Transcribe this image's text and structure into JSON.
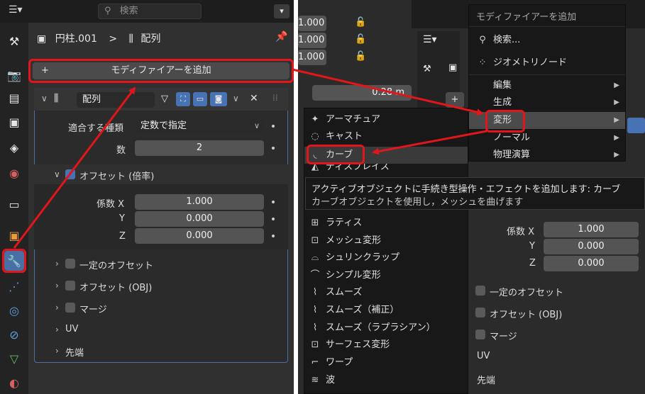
{
  "left": {
    "search_placeholder": "検索",
    "breadcrumb_object": "円柱.001",
    "breadcrumb_sep": ">",
    "breadcrumb_modifier": "配列",
    "add_modifier_label": "モディファイアーを追加",
    "modifier_name": "配列",
    "fit_type_label": "適合する種類",
    "fit_type_value": "定数で指定",
    "count_label": "数",
    "count_value": "2",
    "offset_header": "オフセット (倍率)",
    "factor_x_label": "係数 X",
    "factor_x_value": "1.000",
    "factor_y_label": "Y",
    "factor_y_value": "0.000",
    "factor_z_label": "Z",
    "factor_z_value": "0.000",
    "sections": [
      "一定のオフセット",
      "オフセット (OBJ)",
      "マージ",
      "UV",
      "先端"
    ]
  },
  "right": {
    "top_values": [
      "1.000",
      "1.000",
      "1.000"
    ],
    "length_value": "0.28 m",
    "menu_title": "モディファイアーを追加",
    "menu_search": "検索...",
    "geometry_nodes": "ジオメトリノード",
    "categories": [
      "編集",
      "生成",
      "変形",
      "ノーマル",
      "物理演算"
    ],
    "deform_items_top": [
      "アーマチュア",
      "キャスト",
      "カーブ",
      "ディスプレイス"
    ],
    "tooltip_line1": "アクティブオブジェクトに手続き型操作・エフェクトを追加します: カーブ",
    "tooltip_line2": "カーブオブジェクトを使用し，メッシュを曲げます",
    "deform_items_bottom": [
      "ラティス",
      "メッシュ変形",
      "シュリンクラップ",
      "シンプル変形",
      "スムーズ",
      "スムーズ（補正）",
      "スムーズ（ラプラシアン）",
      "サーフェス変形",
      "ワープ",
      "波"
    ],
    "factor_x_label": "係数 X",
    "factor_x_value": "1.000",
    "factor_y_label": "Y",
    "factor_y_value": "0.000",
    "factor_z_label": "Z",
    "factor_z_value": "0.000",
    "sections": [
      "一定のオフセット",
      "オフセット (OBJ)",
      "マージ",
      "UV",
      "先端"
    ]
  },
  "colors": {
    "highlight_red": "#e0161b",
    "accent_blue": "#4772b3",
    "panel": "#303030"
  }
}
